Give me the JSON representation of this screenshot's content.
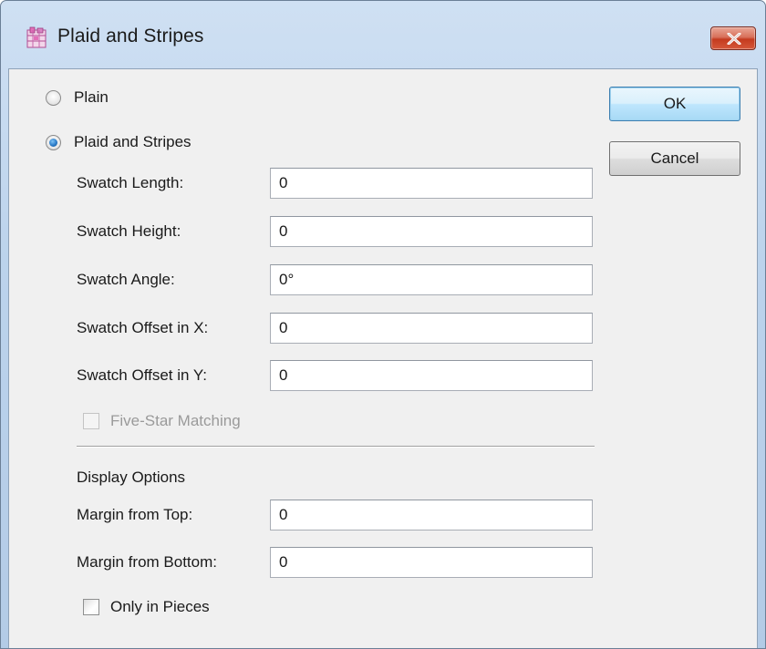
{
  "window": {
    "title": "Plaid and Stripes",
    "app_icon": "plaid-app-icon",
    "close_icon": "close-x-icon"
  },
  "mode": {
    "plain_label": "Plain",
    "plaid_label": "Plaid and Stripes",
    "selected": "Plaid and Stripes"
  },
  "swatch": {
    "length_label": "Swatch Length:",
    "length_value": "0",
    "height_label": "Swatch Height:",
    "height_value": "0",
    "angle_label": "Swatch Angle:",
    "angle_value": "0°",
    "offset_x_label": "Swatch Offset in X:",
    "offset_x_value": "0",
    "offset_y_label": "Swatch Offset in Y:",
    "offset_y_value": "0"
  },
  "five_star": {
    "label": "Five-Star Matching",
    "checked": false,
    "enabled": false
  },
  "display": {
    "section_title": "Display Options",
    "margin_top_label": "Margin from Top:",
    "margin_top_value": "0",
    "margin_bottom_label": "Margin from Bottom:",
    "margin_bottom_value": "0",
    "only_in_pieces_label": "Only in Pieces",
    "only_in_pieces_checked": false
  },
  "buttons": {
    "ok_label": "OK",
    "cancel_label": "Cancel"
  },
  "colors": {
    "title_gradient_top": "#cfe0f3",
    "close_button": "#c43b1f",
    "default_button_border": "#3c7fb1",
    "dialog_background": "#f0f0f0"
  }
}
